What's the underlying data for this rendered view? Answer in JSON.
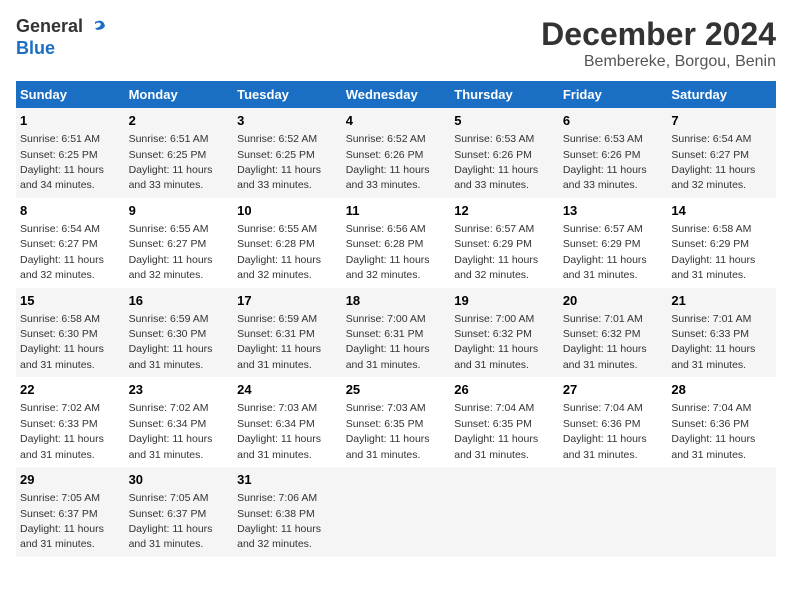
{
  "logo": {
    "line1": "General",
    "line2": "Blue"
  },
  "title": "December 2024",
  "location": "Bembereke, Borgou, Benin",
  "days_of_week": [
    "Sunday",
    "Monday",
    "Tuesday",
    "Wednesday",
    "Thursday",
    "Friday",
    "Saturday"
  ],
  "weeks": [
    [
      {
        "num": "1",
        "rise": "6:51 AM",
        "set": "6:25 PM",
        "daylight": "11 hours and 34 minutes."
      },
      {
        "num": "2",
        "rise": "6:51 AM",
        "set": "6:25 PM",
        "daylight": "11 hours and 33 minutes."
      },
      {
        "num": "3",
        "rise": "6:52 AM",
        "set": "6:25 PM",
        "daylight": "11 hours and 33 minutes."
      },
      {
        "num": "4",
        "rise": "6:52 AM",
        "set": "6:26 PM",
        "daylight": "11 hours and 33 minutes."
      },
      {
        "num": "5",
        "rise": "6:53 AM",
        "set": "6:26 PM",
        "daylight": "11 hours and 33 minutes."
      },
      {
        "num": "6",
        "rise": "6:53 AM",
        "set": "6:26 PM",
        "daylight": "11 hours and 33 minutes."
      },
      {
        "num": "7",
        "rise": "6:54 AM",
        "set": "6:27 PM",
        "daylight": "11 hours and 32 minutes."
      }
    ],
    [
      {
        "num": "8",
        "rise": "6:54 AM",
        "set": "6:27 PM",
        "daylight": "11 hours and 32 minutes."
      },
      {
        "num": "9",
        "rise": "6:55 AM",
        "set": "6:27 PM",
        "daylight": "11 hours and 32 minutes."
      },
      {
        "num": "10",
        "rise": "6:55 AM",
        "set": "6:28 PM",
        "daylight": "11 hours and 32 minutes."
      },
      {
        "num": "11",
        "rise": "6:56 AM",
        "set": "6:28 PM",
        "daylight": "11 hours and 32 minutes."
      },
      {
        "num": "12",
        "rise": "6:57 AM",
        "set": "6:29 PM",
        "daylight": "11 hours and 32 minutes."
      },
      {
        "num": "13",
        "rise": "6:57 AM",
        "set": "6:29 PM",
        "daylight": "11 hours and 31 minutes."
      },
      {
        "num": "14",
        "rise": "6:58 AM",
        "set": "6:29 PM",
        "daylight": "11 hours and 31 minutes."
      }
    ],
    [
      {
        "num": "15",
        "rise": "6:58 AM",
        "set": "6:30 PM",
        "daylight": "11 hours and 31 minutes."
      },
      {
        "num": "16",
        "rise": "6:59 AM",
        "set": "6:30 PM",
        "daylight": "11 hours and 31 minutes."
      },
      {
        "num": "17",
        "rise": "6:59 AM",
        "set": "6:31 PM",
        "daylight": "11 hours and 31 minutes."
      },
      {
        "num": "18",
        "rise": "7:00 AM",
        "set": "6:31 PM",
        "daylight": "11 hours and 31 minutes."
      },
      {
        "num": "19",
        "rise": "7:00 AM",
        "set": "6:32 PM",
        "daylight": "11 hours and 31 minutes."
      },
      {
        "num": "20",
        "rise": "7:01 AM",
        "set": "6:32 PM",
        "daylight": "11 hours and 31 minutes."
      },
      {
        "num": "21",
        "rise": "7:01 AM",
        "set": "6:33 PM",
        "daylight": "11 hours and 31 minutes."
      }
    ],
    [
      {
        "num": "22",
        "rise": "7:02 AM",
        "set": "6:33 PM",
        "daylight": "11 hours and 31 minutes."
      },
      {
        "num": "23",
        "rise": "7:02 AM",
        "set": "6:34 PM",
        "daylight": "11 hours and 31 minutes."
      },
      {
        "num": "24",
        "rise": "7:03 AM",
        "set": "6:34 PM",
        "daylight": "11 hours and 31 minutes."
      },
      {
        "num": "25",
        "rise": "7:03 AM",
        "set": "6:35 PM",
        "daylight": "11 hours and 31 minutes."
      },
      {
        "num": "26",
        "rise": "7:04 AM",
        "set": "6:35 PM",
        "daylight": "11 hours and 31 minutes."
      },
      {
        "num": "27",
        "rise": "7:04 AM",
        "set": "6:36 PM",
        "daylight": "11 hours and 31 minutes."
      },
      {
        "num": "28",
        "rise": "7:04 AM",
        "set": "6:36 PM",
        "daylight": "11 hours and 31 minutes."
      }
    ],
    [
      {
        "num": "29",
        "rise": "7:05 AM",
        "set": "6:37 PM",
        "daylight": "11 hours and 31 minutes."
      },
      {
        "num": "30",
        "rise": "7:05 AM",
        "set": "6:37 PM",
        "daylight": "11 hours and 31 minutes."
      },
      {
        "num": "31",
        "rise": "7:06 AM",
        "set": "6:38 PM",
        "daylight": "11 hours and 32 minutes."
      },
      null,
      null,
      null,
      null
    ]
  ]
}
